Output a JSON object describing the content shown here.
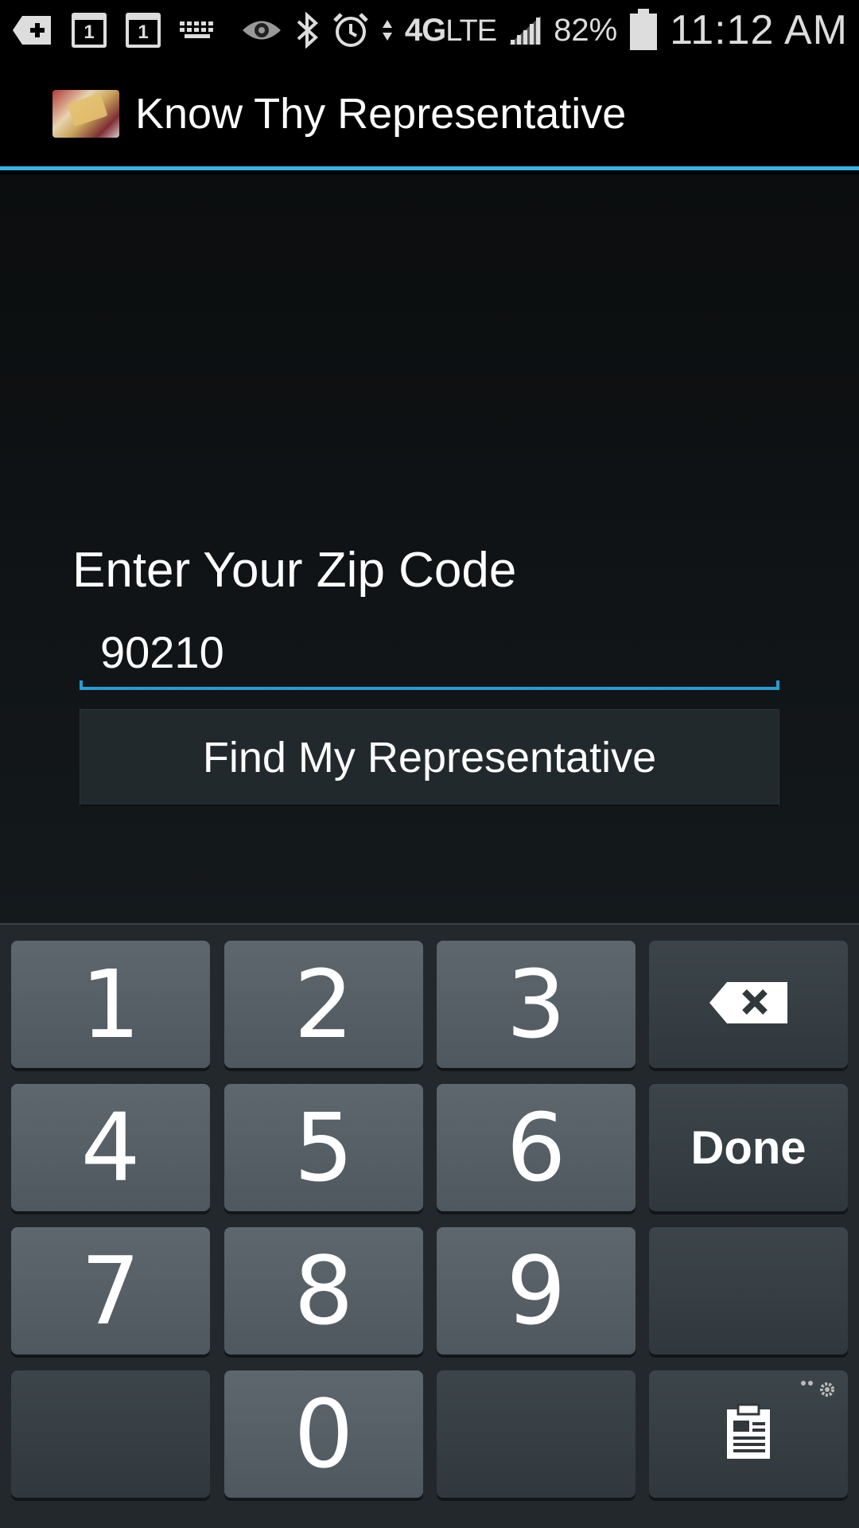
{
  "status_bar": {
    "calendar_1": "1",
    "calendar_2": "1",
    "network": "4G",
    "network_lte": "LTE",
    "battery": "82%",
    "time": "11:12 AM",
    "icons": [
      "add-notification-icon",
      "calendar-icon",
      "calendar-icon",
      "keyboard-icon",
      "eye-icon",
      "bluetooth-icon",
      "alarm-icon",
      "data-arrows-icon",
      "signal-icon",
      "battery-icon"
    ]
  },
  "action_bar": {
    "title": "Know Thy Representative",
    "accent_color": "#33b5e5"
  },
  "form": {
    "label": "Enter Your Zip Code",
    "zip_value": "90210",
    "button_label": "Find My Representative"
  },
  "keyboard": {
    "keys": [
      "1",
      "2",
      "3",
      "4",
      "5",
      "6",
      "7",
      "8",
      "9",
      "0"
    ],
    "done_label": "Done",
    "icons": [
      "backspace-icon",
      "clipboard-icon",
      "settings-icon"
    ]
  }
}
